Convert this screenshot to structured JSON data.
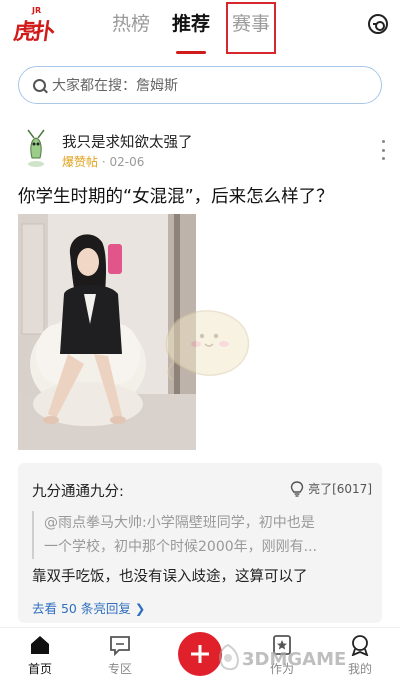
{
  "header": {
    "logo_main": "虎扑",
    "logo_jr": "JR",
    "tabs": [
      {
        "label": "热榜"
      },
      {
        "label": "推荐"
      },
      {
        "label": "赛事"
      }
    ]
  },
  "search": {
    "placeholder": "大家都在搜：詹姆斯"
  },
  "post": {
    "username": "我只是求知欲太强了",
    "tag": "爆赞帖",
    "date": "· 02-06",
    "title": "你学生时期的“女混混”，后来怎么样了？"
  },
  "comment": {
    "author": "九分通通九分:",
    "like_text": "亮了[6017]",
    "quote_line1": "@雨点拳马大帅:小学隔壁班同学，初中也是",
    "quote_line2": "一个学校，初中那个时候2000年，刚刚有...",
    "text": "靠双手吃饭，也没有误入歧途，这算可以了",
    "more_link": "去看 50 条亮回复 ❯"
  },
  "bottom_nav": {
    "items": [
      {
        "label": "首页"
      },
      {
        "label": "专区"
      },
      {
        "label": "作为"
      },
      {
        "label": "我的"
      }
    ]
  },
  "watermark": {
    "text": "3DMGAME"
  },
  "colors": {
    "brand_red": "#d11a1a",
    "link_blue": "#2f6fbf",
    "tag_orange": "#e0a21a"
  }
}
